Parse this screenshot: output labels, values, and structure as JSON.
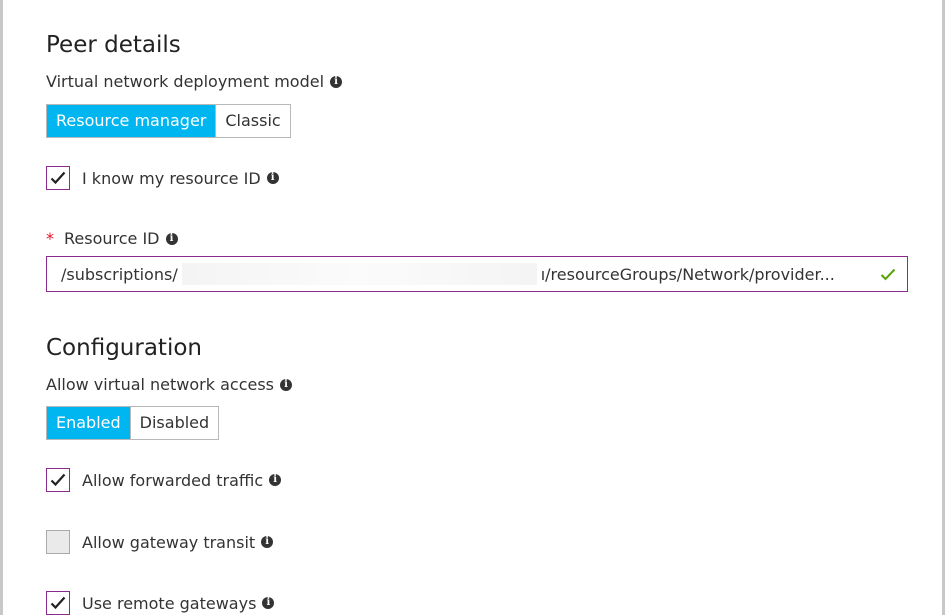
{
  "peer_details": {
    "title": "Peer details",
    "deployment_model_label": "Virtual network deployment model",
    "deployment_model_options": [
      {
        "label": "Resource manager",
        "active": true
      },
      {
        "label": "Classic",
        "active": false
      }
    ],
    "know_resource_id": {
      "label": "I know my resource ID",
      "checked": true
    },
    "resource_id_label": "Resource ID",
    "required_mark": "*",
    "resource_id_value_prefix": "/subscriptions/",
    "resource_id_value_suffix": "ı/resourceGroups/Network/provider...",
    "resource_id_valid": true
  },
  "configuration": {
    "title": "Configuration",
    "vnet_access_label": "Allow virtual network access",
    "vnet_access_options": [
      {
        "label": "Enabled",
        "active": true
      },
      {
        "label": "Disabled",
        "active": false
      }
    ],
    "checkboxes": [
      {
        "label": "Allow forwarded traffic",
        "checked": true
      },
      {
        "label": "Allow gateway transit",
        "checked": false
      },
      {
        "label": "Use remote gateways",
        "checked": true
      }
    ]
  },
  "icons": {
    "info": "info-icon",
    "check": "checkmark-icon",
    "valid": "valid-check-icon"
  },
  "colors": {
    "accent": "#00b6f0",
    "focus_border": "#8a2a8f",
    "required": "#e81123",
    "valid": "#57a300"
  },
  "info_glyph": "i"
}
